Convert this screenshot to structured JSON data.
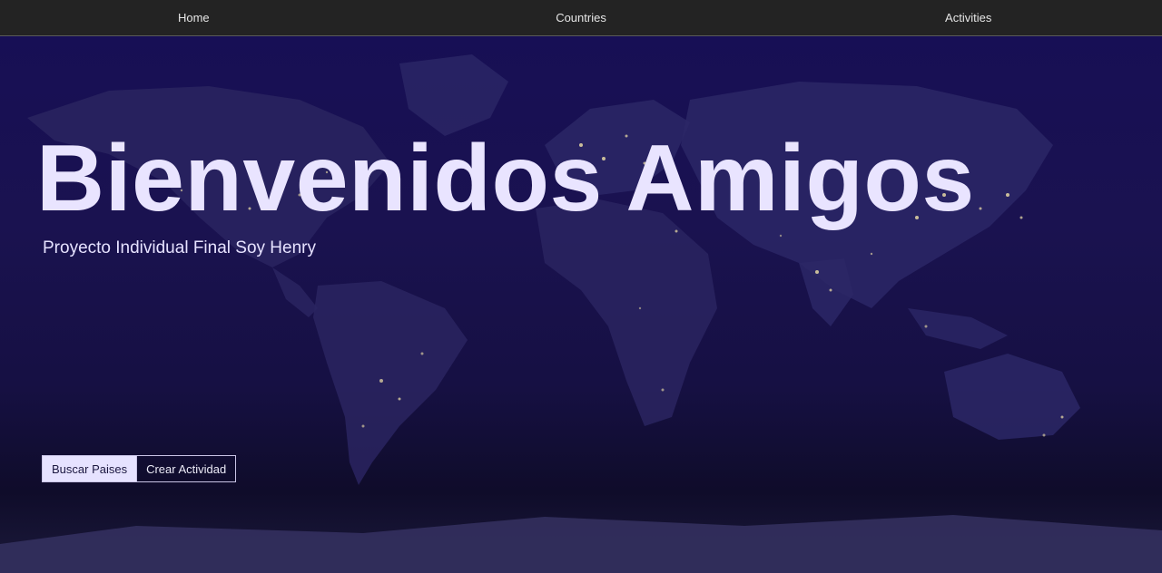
{
  "nav": {
    "items": [
      {
        "label": "Home"
      },
      {
        "label": "Countries"
      },
      {
        "label": "Activities"
      }
    ]
  },
  "hero": {
    "title": "Bienvenidos Amigos",
    "subtitle": "Proyecto Individual Final Soy Henry",
    "background": "world-map-night-lights"
  },
  "actions": {
    "search_countries_label": "Buscar Paises",
    "create_activity_label": "Crear Actividad"
  },
  "colors": {
    "navbar_bg": "#232323",
    "hero_bg": "#170f55",
    "title_text": "#e9e4ff",
    "button_primary_bg": "#e6e2ff"
  }
}
